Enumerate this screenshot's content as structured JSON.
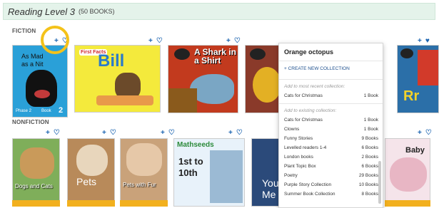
{
  "header": {
    "title": "Reading Level 3",
    "count": "(50 BOOKS)"
  },
  "sections": {
    "fiction": "FICTION",
    "nonfiction": "NONFICTION"
  },
  "icons": {
    "add": "+",
    "heart": "♡",
    "heart_filled": "♥",
    "plus": "+"
  },
  "books": {
    "mad": {
      "line1": "As Mad",
      "line2": "as a Nit",
      "phase": "Phase 2",
      "book": "Book",
      "num": "2"
    },
    "bill": {
      "badge": "First Facts",
      "title": "Bill"
    },
    "shark": {
      "title": "A Shark in a Shirt"
    },
    "rr": {
      "letters": "Rr"
    },
    "dogs": {
      "caption": "Dogs and Cats"
    },
    "pets": {
      "caption": "Pets"
    },
    "petswith": {
      "caption": "Pets with Fur"
    },
    "maths": {
      "brand": "Mathseeds",
      "line1": "1st to",
      "line2": "10th"
    },
    "you": {
      "line1": "You",
      "line2": "Me"
    },
    "baby": {
      "title": "Baby"
    }
  },
  "popup": {
    "title": "Orange octopus",
    "create": "CREATE NEW COLLECTION",
    "recent_hint": "Add to most recent collection:",
    "recent": {
      "name": "Cats for Christmas",
      "count": "1 Book"
    },
    "existing_hint": "Add to existing collection:",
    "collections": [
      {
        "name": "Cats for Christmas",
        "count": "1 Book"
      },
      {
        "name": "Clowns",
        "count": "1 Book"
      },
      {
        "name": "Funny Stories",
        "count": "9 Books"
      },
      {
        "name": "Levelled readers 1-4",
        "count": "6 Books"
      },
      {
        "name": "London books",
        "count": "2 Books"
      },
      {
        "name": "Plant Topic Box",
        "count": "6 Books"
      },
      {
        "name": "Poetry",
        "count": "29 Books"
      },
      {
        "name": "Purple Story Collection",
        "count": "10 Books"
      },
      {
        "name": "Summer Book Collection",
        "count": "8 Books"
      }
    ]
  }
}
